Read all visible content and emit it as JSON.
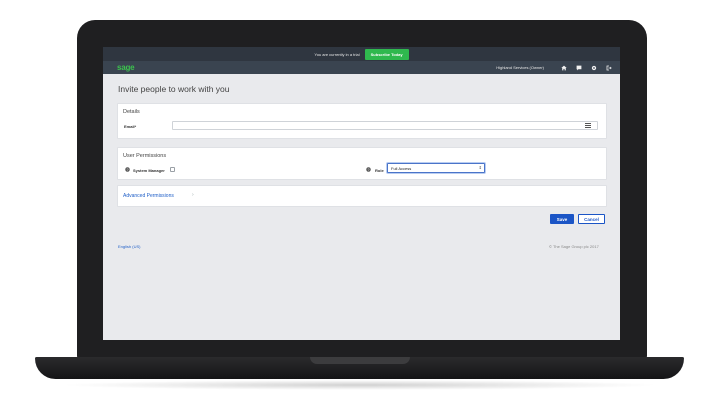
{
  "trial_bar": {
    "message": "You are currently in a trial",
    "subscribe_label": "Subscribe Today"
  },
  "nav": {
    "logo": "sage",
    "business_name": "Highland Services (Owner)",
    "icons": [
      "home-icon",
      "chat-icon",
      "gear-icon",
      "logout-icon"
    ]
  },
  "page": {
    "title": "Invite people to work with you"
  },
  "details": {
    "section_title": "Details",
    "email_label": "Email*",
    "email_value": ""
  },
  "permissions": {
    "section_title": "User Permissions",
    "system_manager_label": "System Manager",
    "system_manager_checked": false,
    "role_label": "Role",
    "role_value": "Full Access"
  },
  "advanced": {
    "link_label": "Advanced Permissions",
    "chevron": "›"
  },
  "actions": {
    "save_label": "Save",
    "cancel_label": "Cancel"
  },
  "footer": {
    "language": "English (US)",
    "copyright": "© The Sage Group plc 2017"
  },
  "colors": {
    "brand_green": "#3cc24e",
    "primary_blue": "#1b55c6",
    "nav_bg": "#3a4450",
    "page_bg": "#e9eaed"
  }
}
